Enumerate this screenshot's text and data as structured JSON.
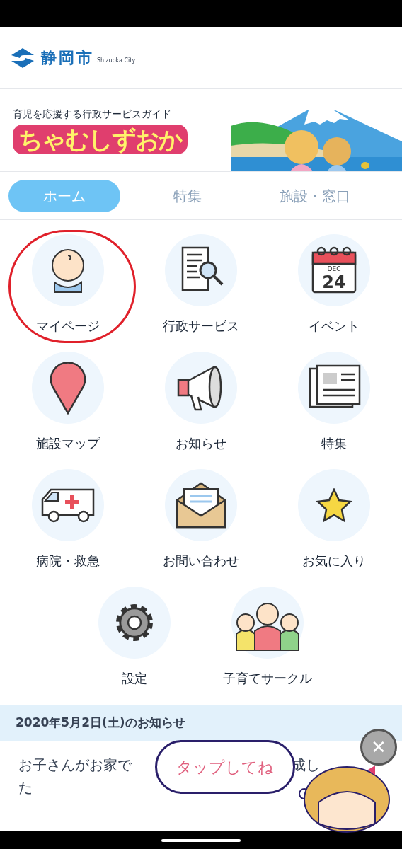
{
  "header": {
    "city_name": "静岡市",
    "city_name_en": "Shizuoka City"
  },
  "banner": {
    "tagline": "育児を応援する行政サービスガイド",
    "app_name": "ちゃむしずおか",
    "kind": "picture"
  },
  "tabs": [
    {
      "label": "ホーム",
      "selected": true
    },
    {
      "label": "特集",
      "selected": false
    },
    {
      "label": "施設・窓口",
      "selected": false
    }
  ],
  "menu": [
    {
      "label": "マイページ",
      "circled": true
    },
    {
      "label": "行政サービス",
      "circled": false
    },
    {
      "label": "イベント",
      "circled": false
    },
    {
      "label": "施設マップ",
      "circled": false
    },
    {
      "label": "お知らせ",
      "circled": false
    },
    {
      "label": "特集",
      "circled": false
    },
    {
      "label": "病院・救急",
      "circled": false
    },
    {
      "label": "お問い合わせ",
      "circled": false
    },
    {
      "label": "お気に入り",
      "circled": false
    },
    {
      "label": "設定",
      "circled": false
    },
    {
      "label": "子育てサークル",
      "circled": false
    }
  ],
  "calendar_icon": {
    "month": "DEC",
    "day": "24"
  },
  "notices": {
    "heading": "2020年5月2日(土)のお知らせ",
    "item_start": "お子さんがお家で",
    "item_mid": "成し",
    "item_end": "た"
  },
  "popup": {
    "bubble": "タップしてね",
    "close": "✕"
  }
}
